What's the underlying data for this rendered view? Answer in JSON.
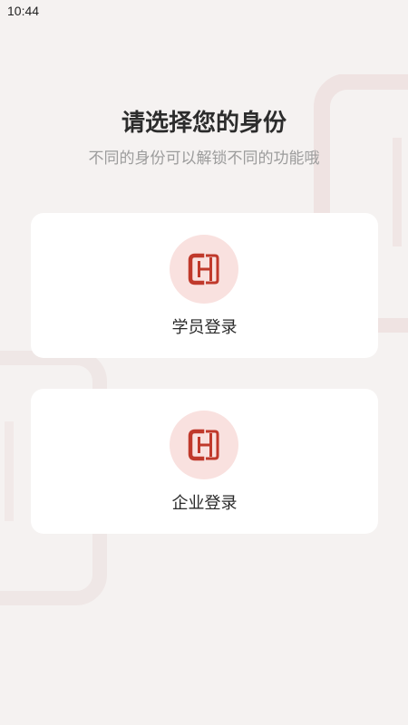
{
  "status_bar": {
    "time": "10:44"
  },
  "header": {
    "title": "请选择您的身份",
    "subtitle": "不同的身份可以解锁不同的功能哦"
  },
  "options": [
    {
      "label": "学员登录",
      "icon": "brand-logo-icon"
    },
    {
      "label": "企业登录",
      "icon": "brand-logo-icon"
    }
  ],
  "colors": {
    "background": "#f5f2f1",
    "card": "#ffffff",
    "icon_circle": "#f9e1df",
    "brand_red": "#c0392b",
    "title_text": "#2c2c2c",
    "subtitle_text": "#9c9c9c"
  }
}
